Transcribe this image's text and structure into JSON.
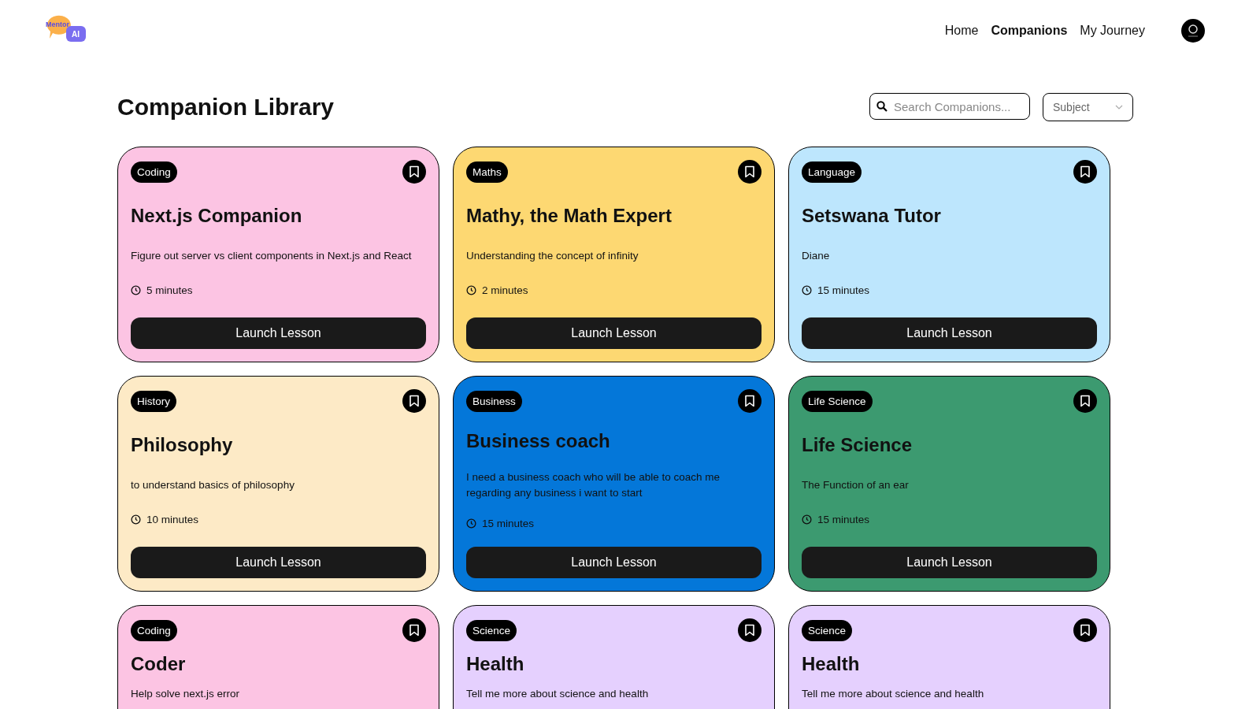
{
  "header": {
    "logo": {
      "words": [
        "Mentor",
        "AI"
      ]
    },
    "nav": [
      {
        "label": "Home",
        "selected": false
      },
      {
        "label": "Companions",
        "selected": true
      },
      {
        "label": "My Journey",
        "selected": false
      }
    ]
  },
  "page_title": "Companion Library",
  "search": {
    "placeholder": "Search Companions..."
  },
  "subject_filter": {
    "placeholder": "Subject"
  },
  "companions": [
    {
      "subject": "Coding",
      "name": "Next.js Companion",
      "topic": "Figure out server vs client components in Next.js and React",
      "duration": "5 minutes",
      "action": "Launch Lesson",
      "color": "#fcc4e3"
    },
    {
      "subject": "Maths",
      "name": "Mathy, the Math Expert",
      "topic": "Understanding the concept of infinity",
      "duration": "2 minutes",
      "action": "Launch Lesson",
      "color": "#fdd872"
    },
    {
      "subject": "Language",
      "name": "Setswana Tutor",
      "topic": "Diane",
      "duration": "15 minutes",
      "action": "Launch Lesson",
      "color": "#bde6fd"
    },
    {
      "subject": "History",
      "name": "Philosophy",
      "topic": "to understand basics of philosophy",
      "duration": "10 minutes",
      "action": "Launch Lesson",
      "color": "#fdeac6"
    },
    {
      "subject": "Business",
      "name": "Business coach",
      "topic": "I need a business coach who will be able to coach me regarding any business i want to start",
      "duration": "15 minutes",
      "action": "Launch Lesson",
      "color": "#0477d9"
    },
    {
      "subject": "Life Science",
      "name": "Life Science",
      "topic": "The Function of an ear",
      "duration": "15 minutes",
      "action": "Launch Lesson",
      "color": "#3c9a70"
    },
    {
      "subject": "Coding",
      "name": "Coder",
      "topic": "Help solve next.js error",
      "color": "#fcc4e3"
    },
    {
      "subject": "Science",
      "name": "Health",
      "topic": "Tell me more about science and health",
      "color": "#e5d0fe"
    },
    {
      "subject": "Science",
      "name": "Health",
      "topic": "Tell me more about science and health",
      "color": "#e5d0fe"
    }
  ]
}
